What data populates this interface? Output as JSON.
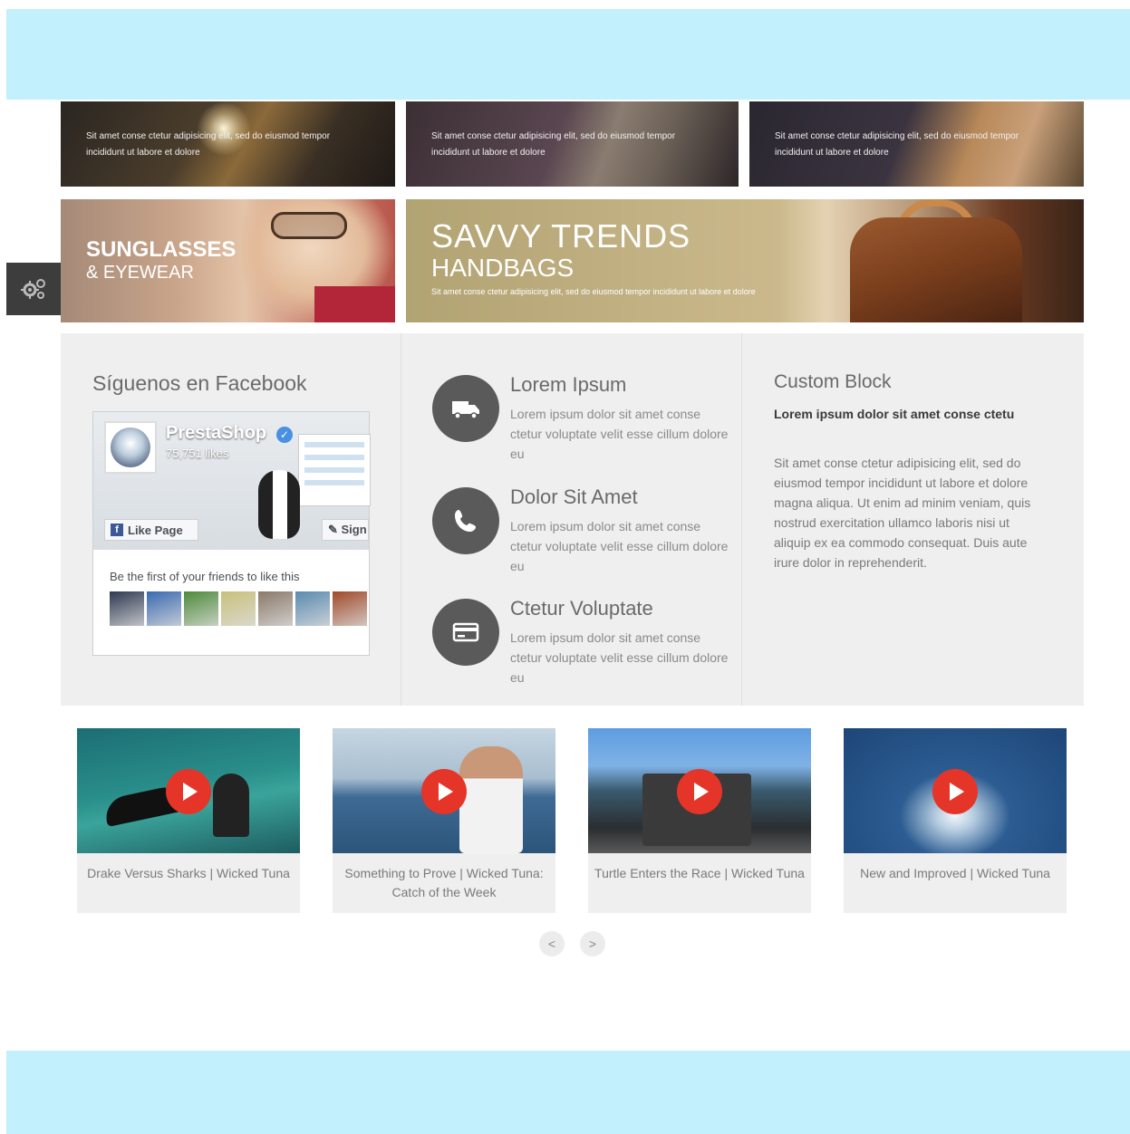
{
  "top_banners": [
    {
      "caption": "Sit amet conse ctetur adipisicing elit, sed do eiusmod tempor incididunt ut labore et dolore"
    },
    {
      "caption": "Sit amet conse ctetur adipisicing elit, sed do eiusmod tempor incididunt ut labore et dolore"
    },
    {
      "caption": "Sit amet conse ctetur adipisicing elit, sed do eiusmod tempor incididunt ut labore et dolore"
    }
  ],
  "sunglasses_banner": {
    "title": "SUNGLASSES",
    "subtitle": "& EYEWEAR"
  },
  "handbags_banner": {
    "title": "SAVVY TRENDS",
    "subtitle": "HANDBAGS",
    "caption": "Sit amet conse ctetur adipisicing elit, sed do eiusmod tempor incididunt ut labore et dolore"
  },
  "settings_tab": {
    "icon": "gears-icon"
  },
  "facebook_block": {
    "title": "Síguenos en Facebook",
    "page_name": "PrestaShop",
    "likes": "75,751 likes",
    "like_button": "Like Page",
    "sign_button": "Sign Up",
    "friends_text": "Be the first of your friends to like this",
    "friend_colors": [
      "#2e3a52",
      "#3a6ab0",
      "#4e8a3a",
      "#c9c07a",
      "#8a7a6a",
      "#5a8ab0",
      "#a04a2a"
    ]
  },
  "services": [
    {
      "icon": "truck-icon",
      "title": "Lorem Ipsum",
      "text": "Lorem ipsum dolor sit amet conse ctetur voluptate velit esse cillum dolore eu"
    },
    {
      "icon": "phone-icon",
      "title": "Dolor Sit Amet",
      "text": "Lorem ipsum dolor sit amet conse ctetur voluptate velit esse cillum dolore eu"
    },
    {
      "icon": "credit-card-icon",
      "title": "Ctetur Voluptate",
      "text": "Lorem ipsum dolor sit amet conse ctetur voluptate velit esse cillum dolore eu"
    }
  ],
  "custom_block": {
    "title": "Custom Block",
    "lead": "Lorem ipsum dolor sit amet conse ctetu",
    "body": "Sit amet conse ctetur adipisicing elit, sed do eiusmod tempor incididunt ut labore et dolore magna aliqua. Ut enim ad minim veniam, quis nostrud exercitation ullamco laboris nisi ut aliquip ex ea commodo consequat. Duis aute irure dolor in reprehenderit."
  },
  "videos": [
    {
      "title": "Drake Versus Sharks | Wicked Tuna"
    },
    {
      "title": "Something to Prove | Wicked Tuna: Catch of the Week"
    },
    {
      "title": "Turtle Enters the Race | Wicked Tuna"
    },
    {
      "title": "New and Improved | Wicked Tuna"
    }
  ],
  "pager": {
    "prev": "<",
    "next": ">"
  },
  "colors": {
    "band": "#c2f0fc",
    "play": "#e53529",
    "icon_circle": "#5a5a5a",
    "panel": "#efefef"
  }
}
